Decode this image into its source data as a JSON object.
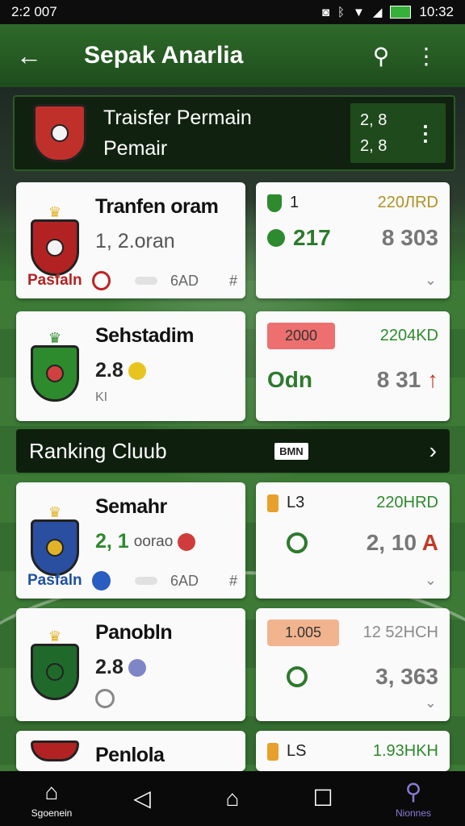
{
  "status_bar": {
    "time": "2:2 007",
    "right_time": "10:32",
    "icons": [
      "nfc-icon",
      "bluetooth-icon",
      "wifi-icon",
      "signal-icon",
      "battery-icon"
    ]
  },
  "app_bar": {
    "title": "Sepak Anarlia",
    "back_icon": "back-arrow-icon",
    "search_icon": "search-icon",
    "menu_icon": "more-vert-icon"
  },
  "banner": {
    "line1": "Traisfer Permain",
    "line2": "Pemair",
    "score_top": "2, 8",
    "score_bottom": "2, 8"
  },
  "cards": [
    {
      "name": "Tranfen oram",
      "stat_main": "1, 2.oran",
      "club": "Pasfaln",
      "foot_text": "6AD",
      "foot_extra": "#",
      "right_top_left": "1",
      "right_top_price": "220ЛRD",
      "right_mid_left": "217",
      "right_mid_right": "8  303"
    },
    {
      "name": "Sehstadim",
      "stat_main": "2.8",
      "foot_text": "KI",
      "right_badge": "2000",
      "right_top_price": "2204KD",
      "right_mid_left": "Odn",
      "right_mid_right": "8  31",
      "right_mid_accent": "↑"
    },
    {
      "name": "Semahr",
      "stat_main": "2, 1",
      "stat_sub": "oorao",
      "club": "Pasfaln",
      "foot_text": "6AD",
      "foot_extra": "#",
      "right_top_left": "L3",
      "right_top_price": "220HRD",
      "right_mid_right": "2, 10",
      "right_mid_accent": "A"
    },
    {
      "name": "Panobln",
      "stat_main": "2.8",
      "right_badge": "1.005",
      "right_top_price": "12 52HCH",
      "right_mid_right": "3, 363"
    },
    {
      "name": "Penlola",
      "right_top_left": "LS",
      "right_top_price": "1.93HKH"
    }
  ],
  "ranking": {
    "label": "Ranking Cluub",
    "tag": "BMN"
  },
  "bottom_nav": {
    "home_label": "Sgoenein",
    "search_label": "Nionnes"
  },
  "colors": {
    "app_bar": "#2f6a2a",
    "accent_green": "#2d8a2d",
    "gold": "#b09224",
    "badge_red": "#ee6f6f"
  }
}
